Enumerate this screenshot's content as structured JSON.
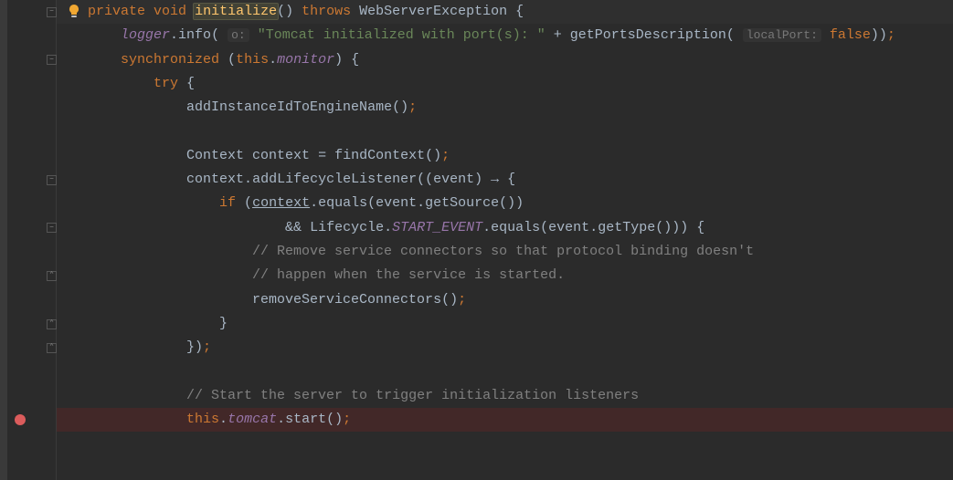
{
  "code": {
    "line1": {
      "private": "private",
      "void": "void",
      "initialize": "initialize",
      "parens": "()",
      "throws": "throws",
      "exception": "WebServerException",
      "brace": " {"
    },
    "line2": {
      "indent": "    ",
      "logger": "logger",
      "dot1": ".",
      "info": "info",
      "open": "(",
      "inlay_o": "o:",
      "str": "\"Tomcat initialized with port(s): \"",
      "plus": " + ",
      "getPorts": "getPortsDescription",
      "open2": "(",
      "inlay_local": "localPort:",
      "false": "false",
      "close": "))",
      "semi": ";"
    },
    "line3": {
      "indent": "    ",
      "synchronized": "synchronized",
      "open": " (",
      "this": "this",
      "dot": ".",
      "monitor": "monitor",
      "close": ")",
      "brace": " {"
    },
    "line4": {
      "indent": "        ",
      "try": "try",
      "brace": " {"
    },
    "line5": {
      "indent": "            ",
      "method": "addInstanceIdToEngineName",
      "parens": "()",
      "semi": ";"
    },
    "line6": "",
    "line7": {
      "indent": "            ",
      "type": "Context",
      "var": " context ",
      "eq": "= ",
      "method": "findContext",
      "parens": "()",
      "semi": ";"
    },
    "line8": {
      "indent": "            ",
      "var": "context",
      "dot": ".",
      "method": "addLifecycleListener",
      "open": "((",
      "param": "event",
      "close": ")",
      "arrow": " → ",
      "brace": "{"
    },
    "line9": {
      "indent": "                ",
      "if": "if",
      "open": " (",
      "context": "context",
      "dot": ".",
      "equals": "equals",
      "open2": "(",
      "event": "event",
      "dot2": ".",
      "getSource": "getSource",
      "parens": "())"
    },
    "line10": {
      "indent": "                        ",
      "and": "&& ",
      "lifecycle": "Lifecycle",
      "dot": ".",
      "start_event": "START_EVENT",
      "dot2": ".",
      "equals": "equals",
      "open": "(",
      "event": "event",
      "dot3": ".",
      "getType": "getType",
      "parens": "()))",
      "brace": " {"
    },
    "line11": {
      "indent": "                    ",
      "comment": "// Remove service connectors so that protocol binding doesn't"
    },
    "line12": {
      "indent": "                    ",
      "comment": "// happen when the service is started."
    },
    "line13": {
      "indent": "                    ",
      "method": "removeServiceConnectors",
      "parens": "()",
      "semi": ";"
    },
    "line14": {
      "indent": "                ",
      "brace": "}"
    },
    "line15": {
      "indent": "            ",
      "close": "})",
      "semi": ";"
    },
    "line16": "",
    "line17": {
      "indent": "            ",
      "comment": "// Start the server to trigger initialization listeners"
    },
    "line18": {
      "indent": "            ",
      "this": "this",
      "dot": ".",
      "tomcat": "tomcat",
      "dot2": ".",
      "start": "start",
      "parens": "()",
      "semi": ";"
    }
  }
}
